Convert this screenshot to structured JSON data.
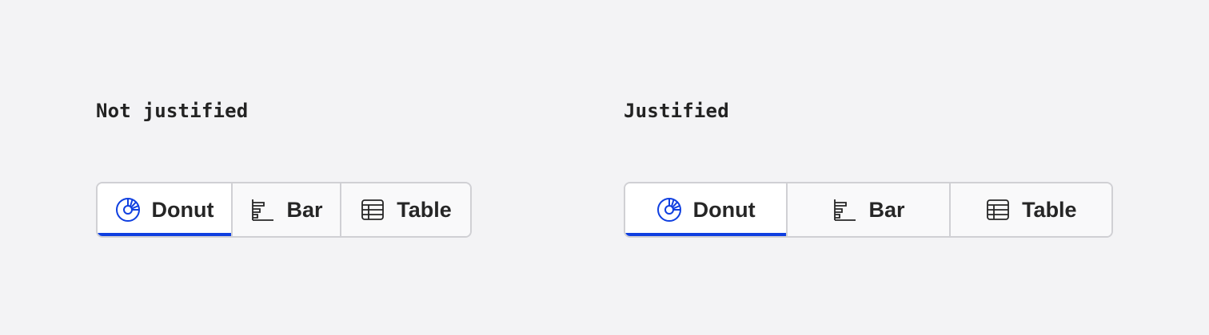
{
  "accent_color": "#0f3fe0",
  "sections": [
    {
      "heading": "Not justified",
      "tabs": [
        {
          "label": "Donut",
          "icon": "donut-chart-icon",
          "selected": true
        },
        {
          "label": "Bar",
          "icon": "bar-chart-icon",
          "selected": false
        },
        {
          "label": "Table",
          "icon": "table-icon",
          "selected": false
        }
      ]
    },
    {
      "heading": "Justified",
      "tabs": [
        {
          "label": "Donut",
          "icon": "donut-chart-icon",
          "selected": true
        },
        {
          "label": "Bar",
          "icon": "bar-chart-icon",
          "selected": false
        },
        {
          "label": "Table",
          "icon": "table-icon",
          "selected": false
        }
      ]
    }
  ]
}
